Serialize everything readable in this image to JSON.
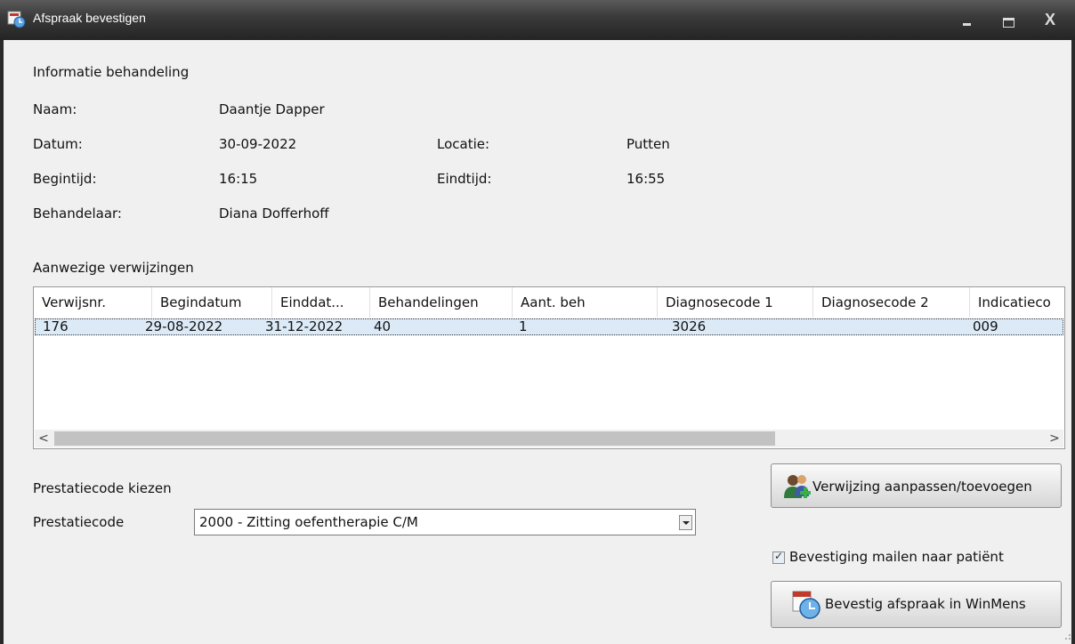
{
  "window": {
    "title": "Afspraak bevestigen",
    "close_glyph": "X"
  },
  "info": {
    "section_title": "Informatie behandeling",
    "naam_label": "Naam:",
    "naam_value": "Daantje Dapper",
    "datum_label": "Datum:",
    "datum_value": "30-09-2022",
    "locatie_label": "Locatie:",
    "locatie_value": "Putten",
    "begintijd_label": "Begintijd:",
    "begintijd_value": "16:15",
    "eindtijd_label": "Eindtijd:",
    "eindtijd_value": "16:55",
    "behandelaar_label": "Behandelaar:",
    "behandelaar_value": "Diana Dofferhoff"
  },
  "referrals": {
    "section_title": "Aanwezige verwijzingen",
    "columns": [
      "Verwijsnr.",
      "Begindatum",
      "Einddat...",
      "Behandelingen",
      "Aant. beh",
      "Diagnosecode 1",
      "Diagnosecode 2",
      "Indicatieco"
    ],
    "rows": [
      [
        "176",
        "29-08-2022",
        "31-12-2022",
        "40",
        "1",
        "3026",
        "",
        "009"
      ]
    ],
    "scroll_left": "<",
    "scroll_right": ">"
  },
  "prestatie": {
    "section_title": "Prestatiecode kiezen",
    "label": "Prestatiecode",
    "selected": "2000 - Zitting oefentherapie C/M"
  },
  "actions": {
    "verwijzing_button": "Verwijzing aanpassen/toevoegen",
    "mail_checkbox_label": "Bevestiging mailen naar patiënt",
    "mail_checked": true,
    "confirm_button": "Bevestig afspraak in WinMens"
  }
}
